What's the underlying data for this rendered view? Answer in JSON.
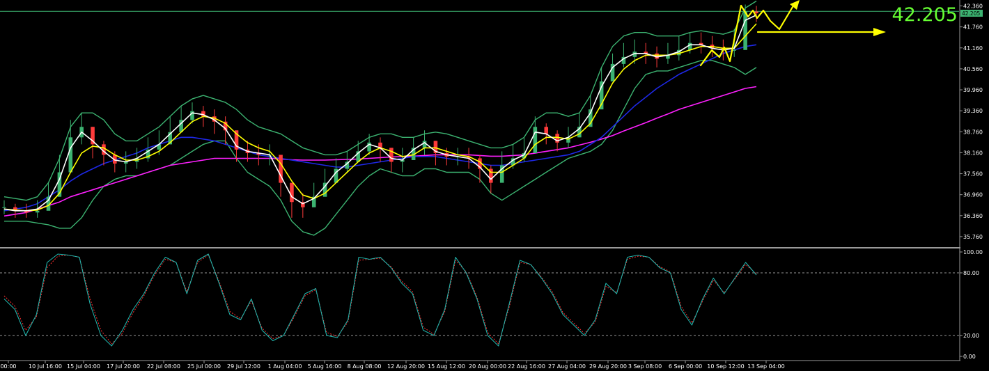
{
  "current_price_label": "42.205",
  "price_tag_label": "42.205",
  "colors": {
    "background": "#000000",
    "bollinger": "#3cb371",
    "ma_blue": "#1e28e6",
    "ma_magenta": "#ff20ff",
    "ma_white": "#ffffff",
    "ma_yellow": "#ffff00",
    "candle_up": "#3cb371",
    "candle_down": "#ff3b3b",
    "stoch_main": "#20b2aa",
    "stoch_signal": "#ff3030",
    "price_big": "#66ff33",
    "price_line": "#3cb371",
    "level_dash": "#c8c8c8",
    "axis_text": "#ffffff"
  },
  "icons": [
    "arrow-up-right-icon",
    "arrow-right-icon"
  ],
  "chart_data": [
    {
      "type": "line",
      "name": "price-panel",
      "grid": false,
      "ylim": [
        35.5,
        42.45
      ],
      "y_ticks": [
        "42.360",
        "41.760",
        "41.160",
        "40.560",
        "39.960",
        "39.360",
        "38.760",
        "38.160",
        "37.560",
        "36.960",
        "36.360",
        "35.760"
      ],
      "x_labels": [
        "00:00",
        "10 Jul 16:00",
        "15 Jul 04:00",
        "17 Jul 20:00",
        "22 Jul 08:00",
        "25 Jul 00:00",
        "29 Jul 12:00",
        "1 Aug 04:00",
        "5 Aug 16:00",
        "8 Aug 08:00",
        "12 Aug 20:00",
        "15 Aug 12:00",
        "20 Aug 00:00",
        "22 Aug 16:00",
        "27 Aug 04:00",
        "29 Aug 20:00",
        "3 Sep 08:00",
        "6 Sep 00:00",
        "10 Sep 12:00",
        "13 Sep 04:00"
      ],
      "current_price": 42.205,
      "close": [
        36.6,
        36.5,
        36.45,
        36.5,
        36.9,
        37.6,
        38.6,
        38.9,
        38.4,
        38.1,
        37.85,
        37.9,
        38.0,
        38.25,
        38.4,
        38.75,
        39.1,
        39.35,
        39.2,
        39.05,
        38.8,
        38.25,
        38.15,
        38.1,
        38.1,
        37.3,
        36.75,
        36.6,
        36.9,
        37.3,
        37.7,
        37.9,
        38.2,
        38.45,
        38.3,
        37.9,
        37.95,
        38.3,
        38.5,
        38.15,
        38.05,
        38.05,
        38.0,
        37.7,
        37.3,
        37.8,
        38.0,
        38.15,
        38.9,
        38.7,
        38.45,
        38.6,
        38.9,
        39.4,
        40.2,
        40.7,
        40.9,
        41.05,
        41.0,
        40.85,
        40.95,
        41.1,
        41.3,
        41.25,
        41.15,
        41.1,
        41.1,
        42.2,
        42.15
      ],
      "high": [
        36.8,
        36.7,
        36.7,
        36.8,
        37.3,
        38.1,
        39.1,
        39.3,
        38.9,
        38.5,
        38.2,
        38.2,
        38.3,
        38.6,
        38.8,
        39.2,
        39.5,
        39.6,
        39.5,
        39.4,
        39.2,
        38.7,
        38.5,
        38.4,
        38.4,
        37.9,
        37.2,
        37.0,
        37.3,
        37.7,
        38.0,
        38.2,
        38.5,
        38.7,
        38.6,
        38.3,
        38.3,
        38.6,
        38.8,
        38.5,
        38.3,
        38.3,
        38.3,
        38.1,
        37.8,
        38.2,
        38.4,
        38.6,
        39.2,
        39.0,
        38.8,
        38.9,
        39.3,
        39.8,
        40.6,
        41.0,
        41.3,
        41.4,
        41.3,
        41.2,
        41.3,
        41.5,
        41.6,
        41.6,
        41.5,
        41.4,
        41.7,
        42.4,
        42.36
      ],
      "low": [
        36.4,
        36.3,
        36.3,
        36.3,
        36.6,
        37.2,
        38.2,
        38.4,
        38.0,
        37.8,
        37.6,
        37.6,
        37.7,
        37.9,
        38.1,
        38.4,
        38.8,
        39.0,
        38.9,
        38.7,
        38.4,
        37.9,
        37.9,
        37.8,
        37.8,
        36.9,
        36.3,
        36.3,
        36.6,
        37.0,
        37.4,
        37.6,
        37.9,
        38.1,
        37.9,
        37.6,
        37.6,
        38.0,
        38.1,
        37.8,
        37.8,
        37.8,
        37.7,
        37.3,
        37.0,
        37.5,
        37.7,
        37.9,
        38.4,
        38.4,
        38.2,
        38.3,
        38.6,
        39.1,
        39.8,
        40.3,
        40.6,
        40.7,
        40.7,
        40.6,
        40.7,
        40.8,
        41.0,
        41.0,
        40.9,
        40.8,
        40.9,
        41.8,
        41.9
      ],
      "series": [
        {
          "values": [
            36.5,
            36.55,
            36.6,
            36.7,
            36.9,
            37.1,
            37.35,
            37.55,
            37.7,
            37.85,
            37.95,
            38.05,
            38.15,
            38.3,
            38.4,
            38.5,
            38.6,
            38.6,
            38.55,
            38.5,
            38.4,
            38.3,
            38.2,
            38.1,
            38.05,
            38.0,
            37.95,
            37.9,
            37.85,
            37.8,
            37.75,
            37.75,
            37.8,
            37.85,
            37.9,
            37.95,
            38.0,
            38.05,
            38.05,
            38.05,
            38.0,
            37.95,
            37.9,
            37.85,
            37.8,
            37.8,
            37.85,
            37.9,
            37.95,
            38.0,
            38.05,
            38.1,
            38.2,
            38.4,
            38.6,
            38.9,
            39.2,
            39.5,
            39.75,
            40.0,
            40.2,
            40.4,
            40.55,
            40.7,
            40.85,
            41.0,
            41.1,
            41.2,
            41.25
          ]
        },
        {
          "values": [
            36.35,
            36.4,
            36.45,
            36.55,
            36.65,
            36.75,
            36.9,
            37.0,
            37.1,
            37.2,
            37.3,
            37.4,
            37.5,
            37.6,
            37.7,
            37.8,
            37.85,
            37.9,
            37.95,
            38.0,
            38.0,
            38.0,
            38.0,
            38.0,
            38.0,
            37.98,
            37.96,
            37.95,
            37.95,
            37.95,
            37.96,
            37.97,
            37.98,
            38.0,
            38.02,
            38.04,
            38.05,
            38.06,
            38.08,
            38.1,
            38.1,
            38.1,
            38.1,
            38.08,
            38.06,
            38.06,
            38.08,
            38.1,
            38.15,
            38.2,
            38.25,
            38.3,
            38.38,
            38.46,
            38.55,
            38.65,
            38.78,
            38.9,
            39.02,
            39.15,
            39.27,
            39.4,
            39.5,
            39.6,
            39.7,
            39.8,
            39.9,
            40.0,
            40.05
          ]
        },
        {
          "values": [
            36.55,
            36.5,
            36.5,
            36.55,
            36.8,
            37.4,
            38.3,
            38.75,
            38.5,
            38.2,
            37.95,
            37.9,
            38.0,
            38.2,
            38.4,
            38.7,
            39.0,
            39.3,
            39.25,
            39.1,
            38.85,
            38.35,
            38.2,
            38.15,
            38.1,
            37.5,
            36.9,
            36.7,
            36.85,
            37.2,
            37.6,
            37.85,
            38.15,
            38.4,
            38.3,
            38.0,
            37.95,
            38.25,
            38.45,
            38.2,
            38.1,
            38.05,
            38.0,
            37.75,
            37.4,
            37.7,
            37.95,
            38.1,
            38.75,
            38.7,
            38.5,
            38.6,
            38.85,
            39.3,
            40.05,
            40.6,
            40.85,
            41.0,
            41.0,
            40.9,
            40.95,
            41.05,
            41.25,
            41.25,
            41.15,
            41.1,
            41.15,
            41.95,
            42.1
          ]
        },
        {
          "values": [
            36.55,
            36.52,
            36.5,
            36.52,
            36.65,
            37.0,
            37.6,
            38.15,
            38.35,
            38.3,
            38.1,
            37.95,
            37.95,
            38.05,
            38.2,
            38.45,
            38.75,
            39.05,
            39.2,
            39.15,
            39.0,
            38.7,
            38.45,
            38.3,
            38.2,
            37.85,
            37.35,
            36.95,
            36.85,
            37.0,
            37.3,
            37.6,
            37.9,
            38.15,
            38.3,
            38.2,
            38.05,
            38.1,
            38.3,
            38.3,
            38.2,
            38.1,
            38.05,
            37.9,
            37.6,
            37.6,
            37.8,
            38.0,
            38.4,
            38.6,
            38.6,
            38.55,
            38.7,
            39.0,
            39.55,
            40.15,
            40.55,
            40.8,
            40.95,
            40.95,
            40.95,
            41.0,
            41.1,
            41.2,
            41.2,
            41.15,
            41.15,
            41.5,
            41.85
          ]
        },
        {
          "values": [
            36.9,
            36.85,
            36.8,
            36.9,
            37.3,
            38.0,
            38.9,
            39.3,
            39.3,
            39.1,
            38.7,
            38.5,
            38.5,
            38.7,
            38.9,
            39.2,
            39.5,
            39.7,
            39.8,
            39.7,
            39.6,
            39.4,
            39.1,
            38.9,
            38.8,
            38.7,
            38.5,
            38.3,
            38.2,
            38.1,
            38.1,
            38.2,
            38.4,
            38.6,
            38.7,
            38.7,
            38.6,
            38.6,
            38.7,
            38.75,
            38.7,
            38.6,
            38.5,
            38.4,
            38.3,
            38.3,
            38.4,
            38.6,
            39.1,
            39.3,
            39.3,
            39.2,
            39.3,
            39.8,
            40.6,
            41.2,
            41.5,
            41.6,
            41.6,
            41.5,
            41.5,
            41.5,
            41.6,
            41.65,
            41.6,
            41.55,
            41.65,
            42.3,
            42.5
          ]
        },
        {
          "values": [
            36.2,
            36.2,
            36.2,
            36.15,
            36.1,
            36.0,
            36.0,
            36.3,
            36.8,
            37.2,
            37.4,
            37.5,
            37.5,
            37.6,
            37.7,
            37.8,
            38.0,
            38.2,
            38.4,
            38.5,
            38.5,
            38.0,
            37.6,
            37.4,
            37.2,
            36.8,
            36.2,
            35.9,
            35.8,
            36.0,
            36.4,
            36.8,
            37.2,
            37.5,
            37.7,
            37.6,
            37.5,
            37.5,
            37.7,
            37.7,
            37.6,
            37.6,
            37.6,
            37.4,
            37.0,
            36.8,
            37.0,
            37.2,
            37.4,
            37.6,
            37.8,
            38.0,
            38.1,
            38.2,
            38.4,
            38.8,
            39.4,
            40.0,
            40.4,
            40.5,
            40.5,
            40.6,
            40.7,
            40.8,
            40.8,
            40.7,
            40.6,
            40.4,
            40.6
          ]
        }
      ]
    },
    {
      "type": "line",
      "name": "stochastic-panel",
      "grid": false,
      "ylim": [
        0,
        100
      ],
      "y_ticks": [
        "100.00",
        "80.00",
        "20.00",
        "0.00"
      ],
      "levels": [
        80,
        20
      ],
      "series": [
        {
          "values": [
            55,
            45,
            20,
            40,
            90,
            98,
            97,
            95,
            50,
            20,
            10,
            25,
            45,
            60,
            80,
            95,
            90,
            60,
            92,
            98,
            70,
            40,
            35,
            55,
            25,
            15,
            20,
            40,
            60,
            65,
            20,
            18,
            35,
            95,
            93,
            95,
            85,
            70,
            60,
            25,
            20,
            45,
            95,
            80,
            55,
            20,
            10,
            50,
            92,
            88,
            75,
            60,
            40,
            30,
            20,
            35,
            70,
            60,
            95,
            97,
            95,
            85,
            80,
            45,
            30,
            55,
            75,
            60,
            75,
            90,
            78
          ]
        },
        {
          "values": [
            58,
            48,
            25,
            38,
            85,
            96,
            97,
            95,
            55,
            25,
            12,
            22,
            42,
            58,
            78,
            93,
            90,
            62,
            90,
            97,
            72,
            43,
            36,
            53,
            27,
            17,
            20,
            38,
            58,
            64,
            23,
            19,
            33,
            92,
            93,
            94,
            86,
            72,
            62,
            28,
            21,
            43,
            92,
            81,
            57,
            23,
            12,
            47,
            90,
            88,
            76,
            62,
            42,
            32,
            22,
            33,
            67,
            61,
            93,
            96,
            95,
            86,
            81,
            48,
            32,
            53,
            73,
            61,
            74,
            88,
            79
          ]
        }
      ]
    }
  ]
}
